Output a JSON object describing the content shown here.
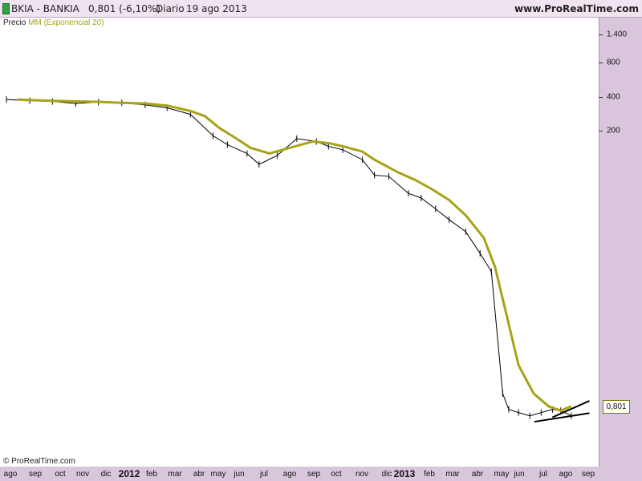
{
  "header": {
    "symbol": "BKIA - BANKIA",
    "quote": "0,801 (-6,10%)",
    "period": "Diario",
    "date": "19 ago 2013",
    "brand": "www.ProRealTime.com"
  },
  "legend": {
    "price_label": "Precio",
    "ma_label": "MM (Exponencial 20)"
  },
  "copyright": "© ProRealTime.com",
  "last_price_label": "0,801",
  "colors": {
    "ma": "#a6a318",
    "price": "#000000",
    "background": "#d9c6dd",
    "plot": "#ffffff"
  },
  "chart_data": {
    "type": "line",
    "title": "",
    "scale": "log",
    "y_ticks": [
      "1.400",
      "800",
      "400",
      "200"
    ],
    "y_tick_values": [
      1400,
      800,
      400,
      200
    ],
    "x_labels": [
      "ago",
      "sep",
      "oct",
      "nov",
      "dic",
      "2012",
      "feb",
      "mar",
      "abr",
      "may",
      "jun",
      "jul",
      "ago",
      "sep",
      "oct",
      "nov",
      "dic",
      "2013",
      "feb",
      "mar",
      "abr",
      "may",
      "jun",
      "jul",
      "ago",
      "sep"
    ],
    "series": [
      {
        "name": "Precio",
        "x": [
          "2011-08-01",
          "2011-09-01",
          "2011-10-01",
          "2011-11-01",
          "2011-12-01",
          "2012-01-01",
          "2012-02-01",
          "2012-03-01",
          "2012-04-01",
          "2012-05-01",
          "2012-05-20",
          "2012-06-15",
          "2012-07-01",
          "2012-07-25",
          "2012-08-20",
          "2012-09-15",
          "2012-10-01",
          "2012-10-20",
          "2012-11-15",
          "2012-12-01",
          "2012-12-20",
          "2013-01-15",
          "2013-02-01",
          "2013-02-20",
          "2013-03-10",
          "2013-04-01",
          "2013-04-20",
          "2013-05-05",
          "2013-05-20",
          "2013-05-28",
          "2013-06-10",
          "2013-06-25",
          "2013-07-10",
          "2013-07-25",
          "2013-08-05",
          "2013-08-19"
        ],
        "values": [
          380,
          370,
          365,
          350,
          360,
          355,
          340,
          320,
          280,
          180,
          150,
          125,
          100,
          120,
          170,
          160,
          145,
          135,
          110,
          80,
          78,
          55,
          50,
          40,
          32,
          25,
          16,
          11,
          1.2,
          0.9,
          0.85,
          0.8,
          0.85,
          0.9,
          0.88,
          0.801
        ]
      },
      {
        "name": "MM (Exponencial 20)",
        "x": [
          "2011-08-15",
          "2011-09-01",
          "2011-10-01",
          "2011-11-01",
          "2011-12-01",
          "2012-01-01",
          "2012-02-01",
          "2012-03-01",
          "2012-04-01",
          "2012-04-20",
          "2012-05-10",
          "2012-06-01",
          "2012-06-20",
          "2012-07-15",
          "2012-08-10",
          "2012-09-10",
          "2012-10-01",
          "2012-10-20",
          "2012-11-15",
          "2012-12-01",
          "2013-01-01",
          "2013-01-25",
          "2013-02-15",
          "2013-03-10",
          "2013-04-01",
          "2013-04-25",
          "2013-05-10",
          "2013-05-25",
          "2013-06-10",
          "2013-06-30",
          "2013-07-20",
          "2013-08-05",
          "2013-08-19"
        ],
        "values": [
          380,
          375,
          370,
          365,
          362,
          355,
          350,
          335,
          300,
          270,
          210,
          170,
          140,
          125,
          140,
          160,
          155,
          145,
          130,
          110,
          85,
          72,
          60,
          48,
          35,
          22,
          12,
          5,
          2,
          1.2,
          0.95,
          0.88,
          0.95
        ]
      }
    ]
  }
}
